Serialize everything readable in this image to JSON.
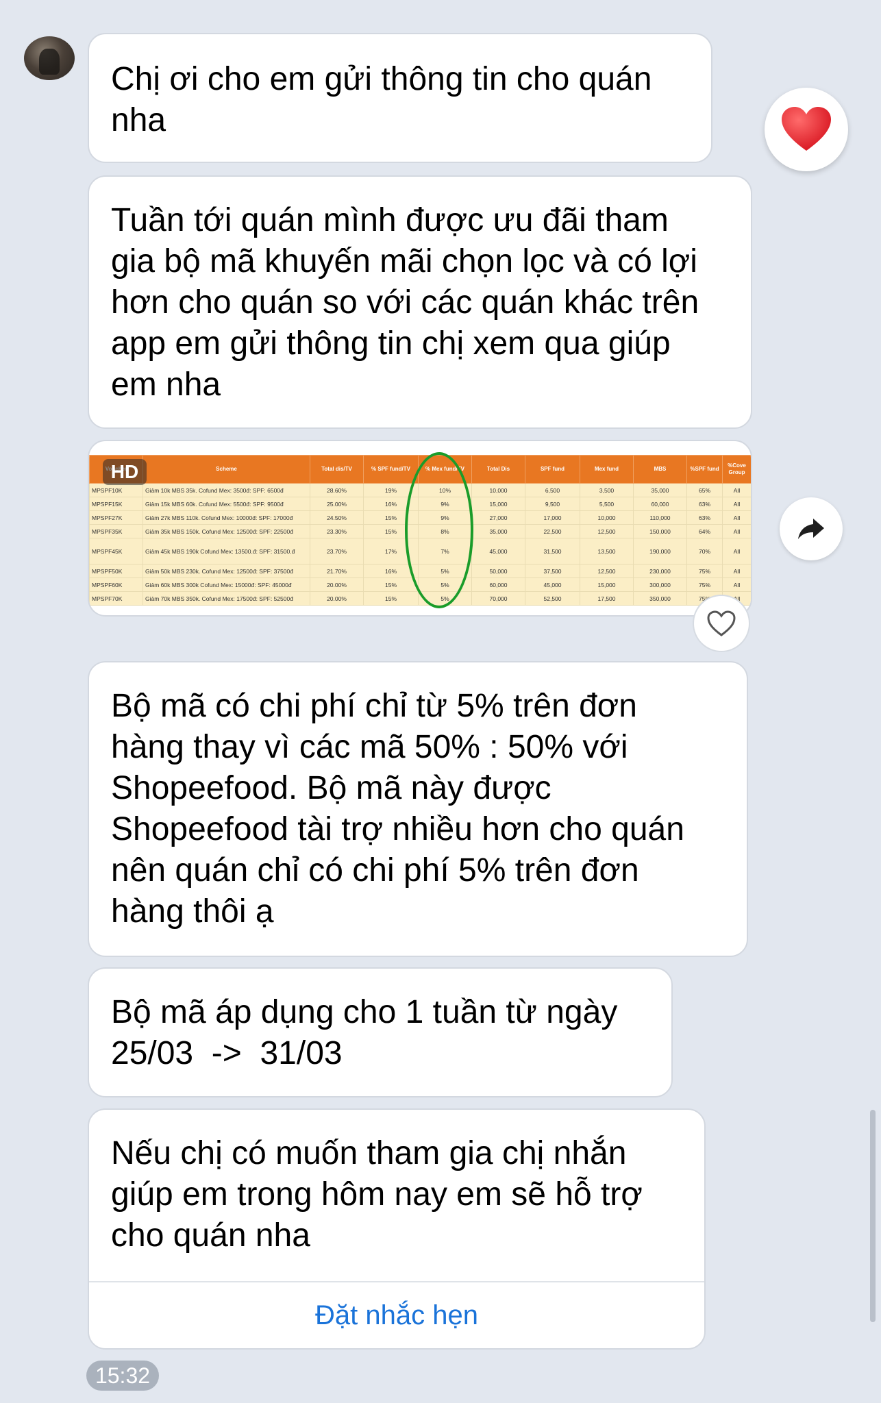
{
  "messages": {
    "m1": "Chị ơi cho em gửi thông tin cho quán\nnha",
    "m2": "Tuần tới quán mình được ưu đãi tham\ngia bộ mã khuyến mãi chọn lọc và có lợi\nhơn cho quán so với các quán khác trên\napp em gửi thông tin chị xem qua giúp\nem nha",
    "m4": "Bộ mã có chi phí chỉ từ 5% trên đơn\nhàng thay vì các mã 50% : 50% với\nShopeefood. Bộ mã này được\nShopeefood tài trợ nhiều hơn cho quán\nnên quán chỉ có chi phí 5% trên đơn\nhàng thôi ạ",
    "m5": "Bộ mã áp dụng cho 1 tuần từ ngày\n25/03  ->  31/03",
    "m6": "Nếu chị có muốn tham gia chị nhắn\ngiúp em trong hôm nay em sẽ hỗ trợ\ncho quán nha",
    "remind_label": "Đặt nhắc hẹn",
    "time": "15:32"
  },
  "image": {
    "hd_label": "HD",
    "headers": [
      "Voucher",
      "Scheme",
      "Total dis/TV",
      "% SPF fund/TV",
      "% Mex fund/TV",
      "Total Dis",
      "SPF fund",
      "Mex fund",
      "MBS",
      "%SPF fund",
      "%Cove Group"
    ],
    "rows": [
      [
        "MPSPF10K",
        "Giảm 10k MBS 35k. Cofund Mex: 3500đ: SPF: 6500đ",
        "28.60%",
        "19%",
        "10%",
        "10,000",
        "6,500",
        "3,500",
        "35,000",
        "65%",
        "All"
      ],
      [
        "MPSPF15K",
        "Giảm 15k MBS 60k. Cofund Mex: 5500đ: SPF: 9500đ",
        "25.00%",
        "16%",
        "9%",
        "15,000",
        "9,500",
        "5,500",
        "60,000",
        "63%",
        "All"
      ],
      [
        "MPSPF27K",
        "Giảm 27k MBS 110k. Cofund Mex: 10000đ: SPF: 17000đ",
        "24.50%",
        "15%",
        "9%",
        "27,000",
        "17,000",
        "10,000",
        "110,000",
        "63%",
        "All"
      ],
      [
        "MPSPF35K",
        "Giảm 35k MBS 150k. Cofund Mex: 12500đ: SPF: 22500đ",
        "23.30%",
        "15%",
        "8%",
        "35,000",
        "22,500",
        "12,500",
        "150,000",
        "64%",
        "All"
      ],
      [
        "MPSPF45K",
        "Giảm 45k MBS 190k Cofund Mex: 13500.đ: SPF: 31500.đ",
        "23.70%",
        "17%",
        "7%",
        "45,000",
        "31,500",
        "13,500",
        "190,000",
        "70%",
        "All"
      ],
      [
        "MPSPF50K",
        "Giảm 50k MBS 230k. Cofund Mex: 12500đ: SPF: 37500đ",
        "21.70%",
        "16%",
        "5%",
        "50,000",
        "37,500",
        "12,500",
        "230,000",
        "75%",
        "All"
      ],
      [
        "MPSPF60K",
        "Giảm 60k MBS 300k Cofund Mex: 15000đ: SPF: 45000đ",
        "20.00%",
        "15%",
        "5%",
        "60,000",
        "45,000",
        "15,000",
        "300,000",
        "75%",
        "All"
      ],
      [
        "MPSPF70K",
        "Giảm 70k MBS 350k. Cofund Mex: 17500đ: SPF: 52500đ",
        "20.00%",
        "15%",
        "5%",
        "70,000",
        "52,500",
        "17,500",
        "350,000",
        "75%",
        "All"
      ]
    ]
  },
  "icons": {
    "reaction": "heart-reaction-icon",
    "share": "share-arrow-icon",
    "like": "heart-outline-icon"
  },
  "colors": {
    "link": "#1a73d9",
    "heart": "#e8232f",
    "sheet_header": "#e87722"
  }
}
